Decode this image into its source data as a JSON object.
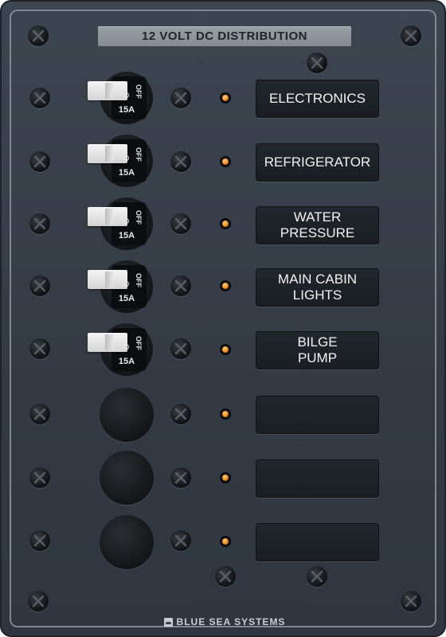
{
  "panel": {
    "title": "12 VOLT DC DISTRIBUTION",
    "brand": "BLUE SEA SYSTEMS",
    "accent_led_color": "#f08a1c",
    "breaker_off_text": "OFF"
  },
  "circuits": [
    {
      "label": "ELECTRONICS",
      "rating": "15A",
      "state": "off"
    },
    {
      "label": "REFRIGERATOR",
      "rating": "15A",
      "state": "off"
    },
    {
      "label": "WATER\nPRESSURE",
      "rating": "15A",
      "state": "off"
    },
    {
      "label": "MAIN CABIN\nLIGHTS",
      "rating": "15A",
      "state": "off"
    },
    {
      "label": "BILGE\nPUMP",
      "rating": "15A",
      "state": "off"
    },
    {
      "label": "",
      "rating": "",
      "state": "blank"
    },
    {
      "label": "",
      "rating": "",
      "state": "blank"
    },
    {
      "label": "",
      "rating": "",
      "state": "blank"
    }
  ]
}
